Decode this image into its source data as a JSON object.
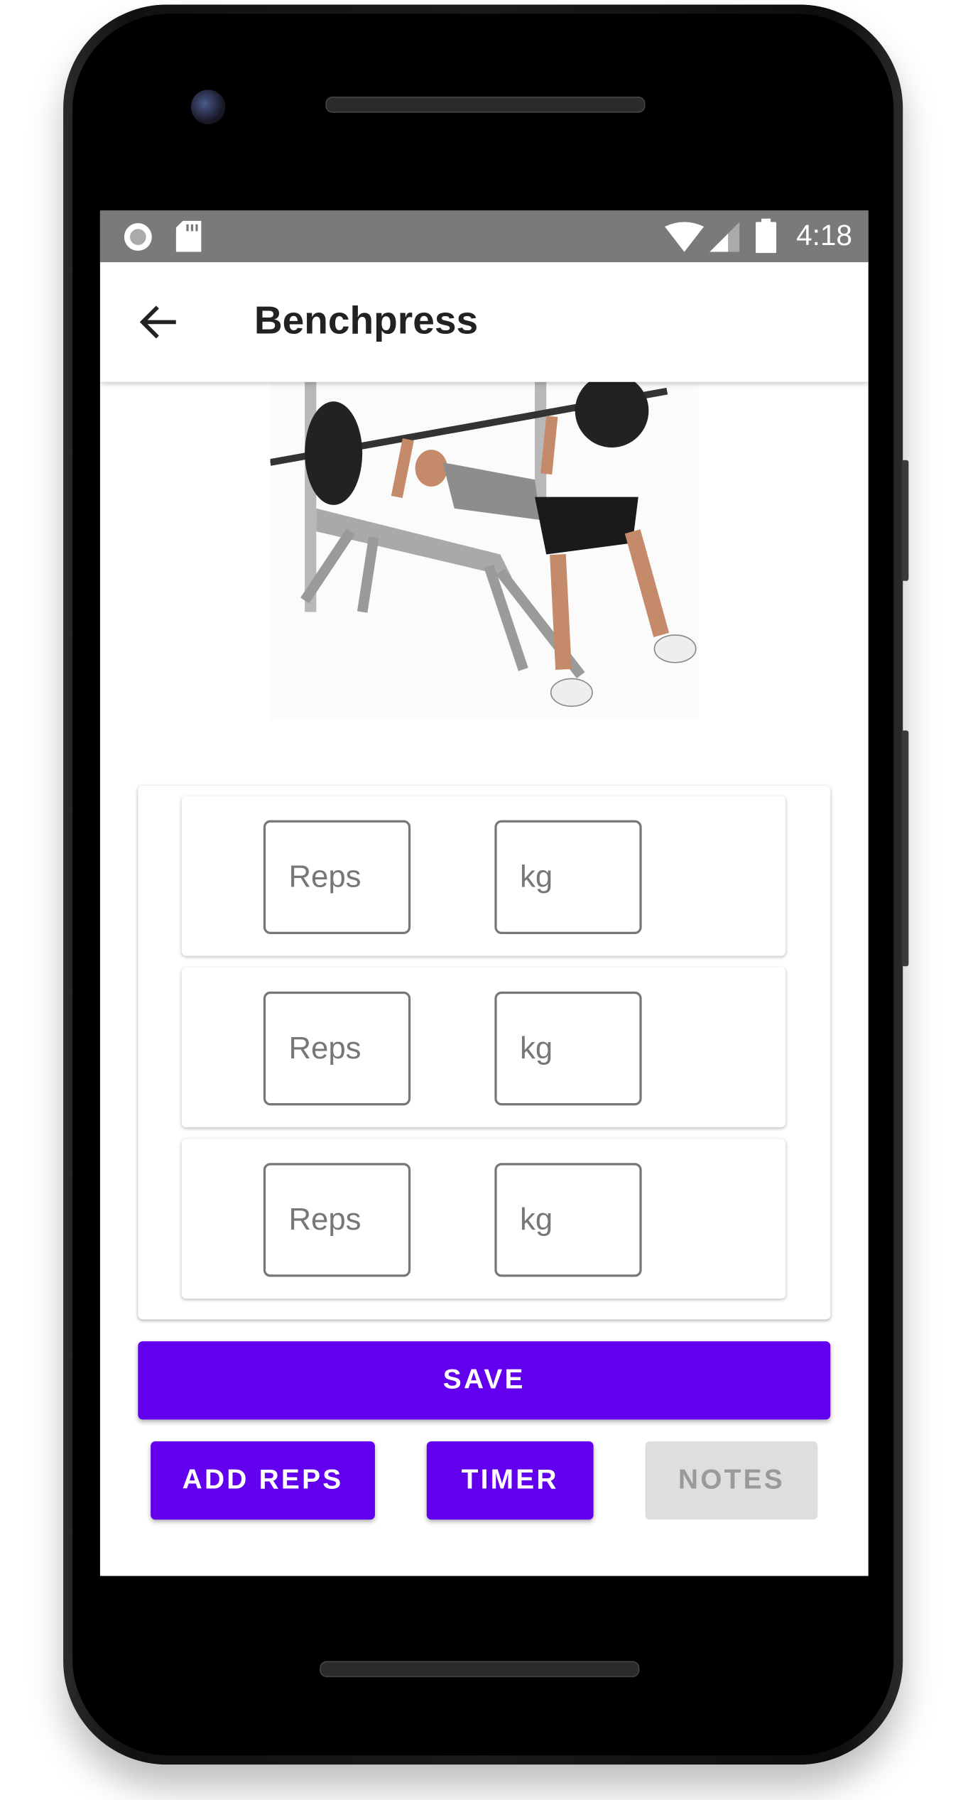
{
  "status_bar": {
    "time": "4:18",
    "icons": [
      "record-icon",
      "sd-card-icon",
      "wifi-icon",
      "signal-icon",
      "battery-icon"
    ]
  },
  "app_bar": {
    "title": "Benchpress",
    "back_icon": "arrow-left-icon"
  },
  "exercise_image": {
    "subject": "bench-press"
  },
  "sets": [
    {
      "reps_placeholder": "Reps",
      "kg_placeholder": "kg"
    },
    {
      "reps_placeholder": "Reps",
      "kg_placeholder": "kg"
    },
    {
      "reps_placeholder": "Reps",
      "kg_placeholder": "kg"
    }
  ],
  "buttons": {
    "save": "SAVE",
    "add_reps": "ADD REPS",
    "timer": "TIMER",
    "notes": "NOTES"
  },
  "colors": {
    "primary": "#6200ee",
    "disabled": "#dedede",
    "status_bar": "#7a7a7a"
  }
}
